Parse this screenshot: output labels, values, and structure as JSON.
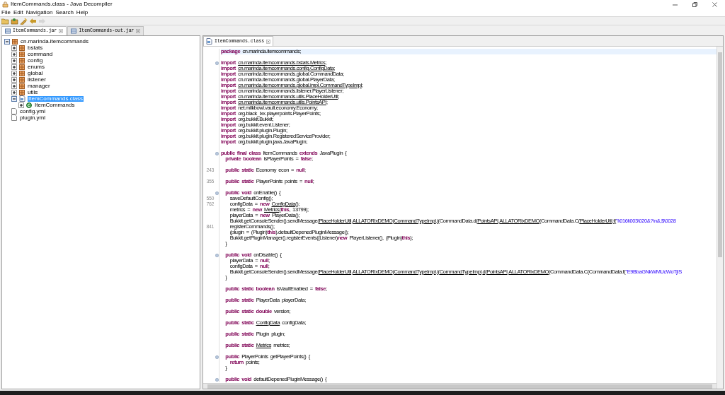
{
  "window": {
    "title": "ItemCommands.class - Java Decompiler"
  },
  "menu": [
    "File",
    "Edit",
    "Navigation",
    "Search",
    "Help"
  ],
  "toolbar": [
    {
      "kind": "folder",
      "disabled": false
    },
    {
      "kind": "type",
      "disabled": false
    },
    {
      "kind": "wand",
      "disabled": false
    },
    {
      "kind": "back",
      "disabled": false
    },
    {
      "kind": "forward",
      "disabled": true
    }
  ],
  "tabs": [
    {
      "label": "ItemCommands.jar",
      "selected": true
    },
    {
      "label": "ItemCommands-out.jar",
      "selected": false
    }
  ],
  "tree": [
    {
      "label": "cn.marinda.itemcommands",
      "kind": "package",
      "expanded": true,
      "selected": false,
      "children": [
        {
          "label": "bstats",
          "kind": "package",
          "expanded": false,
          "selected": false
        },
        {
          "label": "command",
          "kind": "package",
          "expanded": false,
          "selected": false
        },
        {
          "label": "config",
          "kind": "package",
          "expanded": false,
          "selected": false
        },
        {
          "label": "enums",
          "kind": "package",
          "expanded": false,
          "selected": false
        },
        {
          "label": "global",
          "kind": "package",
          "expanded": false,
          "selected": false
        },
        {
          "label": "listener",
          "kind": "package",
          "expanded": false,
          "selected": false
        },
        {
          "label": "manager",
          "kind": "package",
          "expanded": false,
          "selected": false
        },
        {
          "label": "utils",
          "kind": "package",
          "expanded": false,
          "selected": false
        },
        {
          "label": "ItemCommands.class",
          "kind": "classfile",
          "expanded": true,
          "selected": true,
          "children": [
            {
              "label": "ItemCommands",
              "kind": "class",
              "expanded": false,
              "selected": false
            }
          ]
        }
      ]
    },
    {
      "label": "config.yml",
      "kind": "file",
      "selected": false
    },
    {
      "label": "plugin.yml",
      "kind": "file",
      "selected": false
    }
  ],
  "editor": {
    "tab": {
      "label": "ItemCommands.class",
      "selected": true
    },
    "lines": [
      {
        "hl": true,
        "t": [
          {
            "kind": "kw",
            "text": "package "
          },
          {
            "kind": "p",
            "text": "cn.marinda.itemcommands;"
          }
        ]
      },
      {
        "hl": false
      },
      {
        "hl": false,
        "fold": true,
        "t": [
          {
            "kind": "kw",
            "text": "import "
          },
          {
            "kind": "u",
            "text": "cn.marinda.itemcommands.bstats.Metrics"
          },
          {
            "kind": "p",
            "text": ";"
          }
        ]
      },
      {
        "hl": false,
        "t": [
          {
            "kind": "kw",
            "text": "import "
          },
          {
            "kind": "u",
            "text": "cn.marinda.itemcommands.config.ConfigData"
          },
          {
            "kind": "p",
            "text": ";"
          }
        ]
      },
      {
        "hl": false,
        "t": [
          {
            "kind": "kw",
            "text": "import "
          },
          {
            "kind": "p",
            "text": "cn.marinda.itemcommands.global.CommandData;"
          }
        ]
      },
      {
        "hl": false,
        "t": [
          {
            "kind": "kw",
            "text": "import "
          },
          {
            "kind": "p",
            "text": "cn.marinda.itemcommands.global.PlayerData;"
          }
        ]
      },
      {
        "hl": false,
        "t": [
          {
            "kind": "kw",
            "text": "import "
          },
          {
            "kind": "u",
            "text": "cn.marinda.itemcommands.global.impl.CommandTypeImpl"
          },
          {
            "kind": "p",
            "text": ";"
          }
        ]
      },
      {
        "hl": false,
        "t": [
          {
            "kind": "kw",
            "text": "import "
          },
          {
            "kind": "p",
            "text": "cn.marinda.itemcommands.listener.PlayerListener;"
          }
        ]
      },
      {
        "hl": false,
        "t": [
          {
            "kind": "kw",
            "text": "import "
          },
          {
            "kind": "u",
            "text": "cn.marinda.itemcommands.utils.PlaceHolderUtil"
          },
          {
            "kind": "p",
            "text": ";"
          }
        ]
      },
      {
        "hl": false,
        "t": [
          {
            "kind": "kw",
            "text": "import "
          },
          {
            "kind": "u",
            "text": "cn.marinda.itemcommands.utils.PointsAPI"
          },
          {
            "kind": "p",
            "text": ";"
          }
        ]
      },
      {
        "hl": false,
        "t": [
          {
            "kind": "kw",
            "text": "import "
          },
          {
            "kind": "p",
            "text": "net.milkbowl.vault.economy.Economy;"
          }
        ]
      },
      {
        "hl": false,
        "t": [
          {
            "kind": "kw",
            "text": "import "
          },
          {
            "kind": "p",
            "text": "org.black_ixx.playerpoints.PlayerPoints;"
          }
        ]
      },
      {
        "hl": false,
        "t": [
          {
            "kind": "kw",
            "text": "import "
          },
          {
            "kind": "p",
            "text": "org.bukkit.Bukkit;"
          }
        ]
      },
      {
        "hl": false,
        "t": [
          {
            "kind": "kw",
            "text": "import "
          },
          {
            "kind": "p",
            "text": "org.bukkit.event.Listener;"
          }
        ]
      },
      {
        "hl": false,
        "t": [
          {
            "kind": "kw",
            "text": "import "
          },
          {
            "kind": "p",
            "text": "org.bukkit.plugin.Plugin;"
          }
        ]
      },
      {
        "hl": false,
        "t": [
          {
            "kind": "kw",
            "text": "import "
          },
          {
            "kind": "p",
            "text": "org.bukkit.plugin.RegisteredServiceProvider;"
          }
        ]
      },
      {
        "hl": false,
        "t": [
          {
            "kind": "kw",
            "text": "import "
          },
          {
            "kind": "p",
            "text": "org.bukkit.plugin.java.JavaPlugin;"
          }
        ]
      },
      {
        "hl": false
      },
      {
        "hl": false,
        "fold": true,
        "t": [
          {
            "kind": "kw",
            "text": "public final class "
          },
          {
            "kind": "p",
            "text": "ItemCommands "
          },
          {
            "kind": "kw",
            "text": "extends "
          },
          {
            "kind": "p",
            "text": "JavaPlugin {"
          }
        ]
      },
      {
        "hl": false,
        "t": [
          {
            "kind": "kw",
            "text": "  private boolean "
          },
          {
            "kind": "p",
            "text": "isPlayerPoints = "
          },
          {
            "kind": "kw",
            "text": "false"
          },
          {
            "kind": "p",
            "text": ";"
          }
        ]
      },
      {
        "hl": false
      },
      {
        "hl": false,
        "num": "243",
        "t": [
          {
            "kind": "kw",
            "text": "  public static "
          },
          {
            "kind": "p",
            "text": "Economy econ = "
          },
          {
            "kind": "kw",
            "text": "null"
          },
          {
            "kind": "p",
            "text": ";"
          }
        ]
      },
      {
        "hl": false
      },
      {
        "hl": false,
        "num": "355",
        "t": [
          {
            "kind": "kw",
            "text": "  public static "
          },
          {
            "kind": "p",
            "text": "PlayerPoints points = "
          },
          {
            "kind": "kw",
            "text": "null"
          },
          {
            "kind": "p",
            "text": ";"
          }
        ]
      },
      {
        "hl": false
      },
      {
        "hl": false,
        "fold": true,
        "t": [
          {
            "kind": "kw",
            "text": "  public void "
          },
          {
            "kind": "p",
            "text": "onEnable() {"
          }
        ]
      },
      {
        "hl": false,
        "num": "550",
        "t": [
          {
            "kind": "p",
            "text": "    saveDefaultConfig();"
          }
        ]
      },
      {
        "hl": false,
        "num": "762",
        "t": [
          {
            "kind": "p",
            "text": "    configData = "
          },
          {
            "kind": "kw",
            "text": "new "
          },
          {
            "kind": "u",
            "text": "ConfigData"
          },
          {
            "kind": "p",
            "text": "();"
          }
        ]
      },
      {
        "hl": false,
        "t": [
          {
            "kind": "p",
            "text": "    metrics = "
          },
          {
            "kind": "kw",
            "text": "new "
          },
          {
            "kind": "u",
            "text": "Metrics"
          },
          {
            "kind": "p",
            "text": "("
          },
          {
            "kind": "kw",
            "text": "this"
          },
          {
            "kind": "p",
            "text": ", 13799);"
          }
        ]
      },
      {
        "hl": false,
        "t": [
          {
            "kind": "p",
            "text": "    playerData = "
          },
          {
            "kind": "kw",
            "text": "new "
          },
          {
            "kind": "p",
            "text": "PlayerData();"
          }
        ]
      },
      {
        "hl": false,
        "t": [
          {
            "kind": "p",
            "text": "    Bukkit.getConsoleSender().sendMessage("
          },
          {
            "kind": "u",
            "text": "PlaceHolderUtil"
          },
          {
            "kind": "p",
            "text": "."
          },
          {
            "kind": "u",
            "text": "ALLATORIxDEMO"
          },
          {
            "kind": "p",
            "text": "("
          },
          {
            "kind": "u",
            "text": "CommandTypeImpl"
          },
          {
            "kind": "p",
            "text": "."
          },
          {
            "kind": "u",
            "text": "i"
          },
          {
            "kind": "p",
            "text": "(CommandData.d("
          },
          {
            "kind": "u",
            "text": "PointsAPI"
          },
          {
            "kind": "p",
            "text": "."
          },
          {
            "kind": "u",
            "text": "ALLATORIxDEMO"
          },
          {
            "kind": "p",
            "text": "(CommandData.C("
          },
          {
            "kind": "u",
            "text": "PlaceHolderUtil"
          },
          {
            "kind": "p",
            "text": "."
          },
          {
            "kind": "u",
            "text": "f"
          },
          {
            "kind": "p",
            "text": "("
          },
          {
            "kind": "s",
            "text": "\"i\\016i\\003\\020&?\\n&,$\\0028"
          }
        ]
      },
      {
        "hl": false,
        "num": "841",
        "t": [
          {
            "kind": "p",
            "text": "    registerCommands();"
          }
        ]
      },
      {
        "hl": false,
        "t": [
          {
            "kind": "p",
            "text": "    (plugin = (Plugin)"
          },
          {
            "kind": "kw",
            "text": "this"
          },
          {
            "kind": "p",
            "text": ").defaultDepenedPluginMessage();"
          }
        ]
      },
      {
        "hl": false,
        "t": [
          {
            "kind": "p",
            "text": "    Bukkit.getPluginManager().registerEvents((Listener)"
          },
          {
            "kind": "kw",
            "text": "new "
          },
          {
            "kind": "p",
            "text": "PlayerListener(), (Plugin)"
          },
          {
            "kind": "kw",
            "text": "this"
          },
          {
            "kind": "p",
            "text": ");"
          }
        ]
      },
      {
        "hl": false,
        "t": [
          {
            "kind": "p",
            "text": "  }"
          }
        ]
      },
      {
        "hl": false
      },
      {
        "hl": false,
        "fold": true,
        "t": [
          {
            "kind": "kw",
            "text": "  public void "
          },
          {
            "kind": "p",
            "text": "onDisable() {"
          }
        ]
      },
      {
        "hl": false,
        "t": [
          {
            "kind": "p",
            "text": "    playerData = "
          },
          {
            "kind": "kw",
            "text": "null"
          },
          {
            "kind": "p",
            "text": ";"
          }
        ]
      },
      {
        "hl": false,
        "t": [
          {
            "kind": "p",
            "text": "    configData = "
          },
          {
            "kind": "kw",
            "text": "null"
          },
          {
            "kind": "p",
            "text": ";"
          }
        ]
      },
      {
        "hl": false,
        "t": [
          {
            "kind": "p",
            "text": "    Bukkit.getConsoleSender().sendMessage("
          },
          {
            "kind": "u",
            "text": "PlaceHolderUtil"
          },
          {
            "kind": "p",
            "text": "."
          },
          {
            "kind": "u",
            "text": "ALLATORIxDEMO"
          },
          {
            "kind": "p",
            "text": "("
          },
          {
            "kind": "u",
            "text": "CommandTypeImpl"
          },
          {
            "kind": "p",
            "text": "."
          },
          {
            "kind": "u",
            "text": "i"
          },
          {
            "kind": "p",
            "text": "("
          },
          {
            "kind": "u",
            "text": "CommandTypeImpl"
          },
          {
            "kind": "p",
            "text": "."
          },
          {
            "kind": "u",
            "text": "d"
          },
          {
            "kind": "p",
            "text": "("
          },
          {
            "kind": "u",
            "text": "PointsAPI"
          },
          {
            "kind": "p",
            "text": "."
          },
          {
            "kind": "u",
            "text": "ALLATORIxDEMO"
          },
          {
            "kind": "p",
            "text": "(CommandData.C(CommandData.f("
          },
          {
            "kind": "s",
            "text": "\"E9BbaGNkWMUcWoTjIS"
          }
        ]
      },
      {
        "hl": false,
        "t": [
          {
            "kind": "p",
            "text": "  }"
          }
        ]
      },
      {
        "hl": false
      },
      {
        "hl": false,
        "t": [
          {
            "kind": "kw",
            "text": "  public static boolean "
          },
          {
            "kind": "p",
            "text": "isVaultEnabled = "
          },
          {
            "kind": "kw",
            "text": "false"
          },
          {
            "kind": "p",
            "text": ";"
          }
        ]
      },
      {
        "hl": false
      },
      {
        "hl": false,
        "t": [
          {
            "kind": "kw",
            "text": "  public static "
          },
          {
            "kind": "p",
            "text": "PlayerData playerData;"
          }
        ]
      },
      {
        "hl": false
      },
      {
        "hl": false,
        "t": [
          {
            "kind": "kw",
            "text": "  public static double "
          },
          {
            "kind": "p",
            "text": "version;"
          }
        ]
      },
      {
        "hl": false
      },
      {
        "hl": false,
        "t": [
          {
            "kind": "kw",
            "text": "  public static "
          },
          {
            "kind": "u",
            "text": "ConfigData"
          },
          {
            "kind": "p",
            "text": " configData;"
          }
        ]
      },
      {
        "hl": false
      },
      {
        "hl": false,
        "t": [
          {
            "kind": "kw",
            "text": "  public static "
          },
          {
            "kind": "p",
            "text": "Plugin plugin;"
          }
        ]
      },
      {
        "hl": false
      },
      {
        "hl": false,
        "t": [
          {
            "kind": "kw",
            "text": "  public static "
          },
          {
            "kind": "u",
            "text": "Metrics"
          },
          {
            "kind": "p",
            "text": " metrics;"
          }
        ]
      },
      {
        "hl": false
      },
      {
        "hl": false,
        "fold": true,
        "t": [
          {
            "kind": "kw",
            "text": "  public "
          },
          {
            "kind": "p",
            "text": "PlayerPoints getPlayerPoints() {"
          }
        ]
      },
      {
        "hl": false,
        "t": [
          {
            "kind": "kw",
            "text": "    return "
          },
          {
            "kind": "p",
            "text": "points;"
          }
        ]
      },
      {
        "hl": false,
        "t": [
          {
            "kind": "p",
            "text": "  }"
          }
        ]
      },
      {
        "hl": false
      },
      {
        "hl": false,
        "fold": true,
        "t": [
          {
            "kind": "kw",
            "text": "  public void "
          },
          {
            "kind": "p",
            "text": "defaultDepenedPluginMessage() {"
          }
        ]
      }
    ]
  }
}
